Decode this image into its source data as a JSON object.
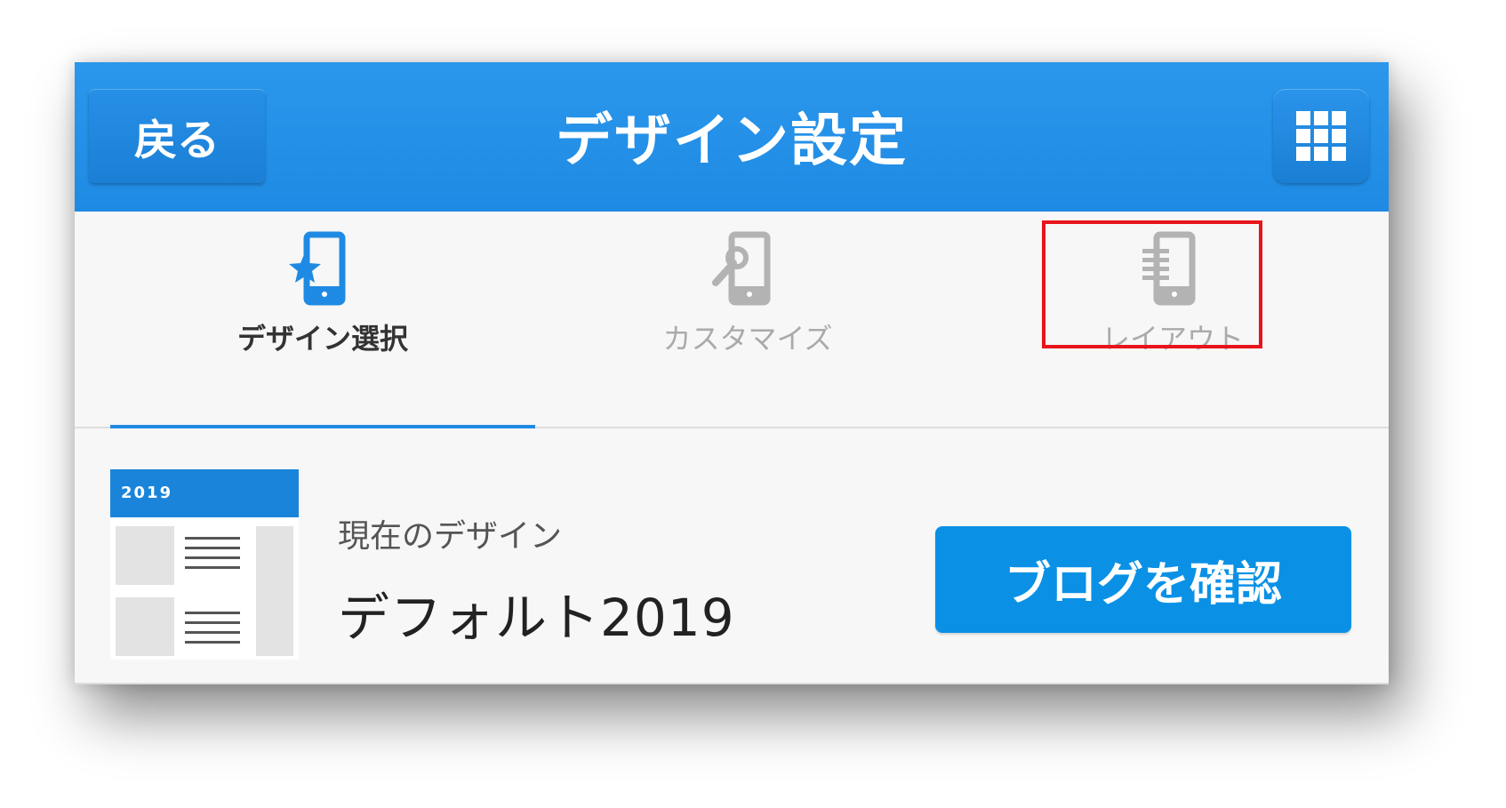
{
  "header": {
    "back_label": "戻る",
    "title": "デザイン設定",
    "grid_icon": "grid-icon"
  },
  "tabs": [
    {
      "label": "デザイン選択",
      "icon": "phone-star-icon",
      "active": true
    },
    {
      "label": "カスタマイズ",
      "icon": "phone-wrench-icon",
      "active": false
    },
    {
      "label": "レイアウト",
      "icon": "phone-layout-icon",
      "active": false
    }
  ],
  "current": {
    "thumbnail_label": "2019",
    "label": "現在のデザイン",
    "name": "デフォルト2019"
  },
  "confirm_label": "ブログを確認",
  "colors": {
    "header": "#1f8ae3",
    "button": "#0a91e6",
    "highlight": "#e8141b",
    "active_tab": "#333333",
    "inactive_tab": "#aaaaaa"
  }
}
